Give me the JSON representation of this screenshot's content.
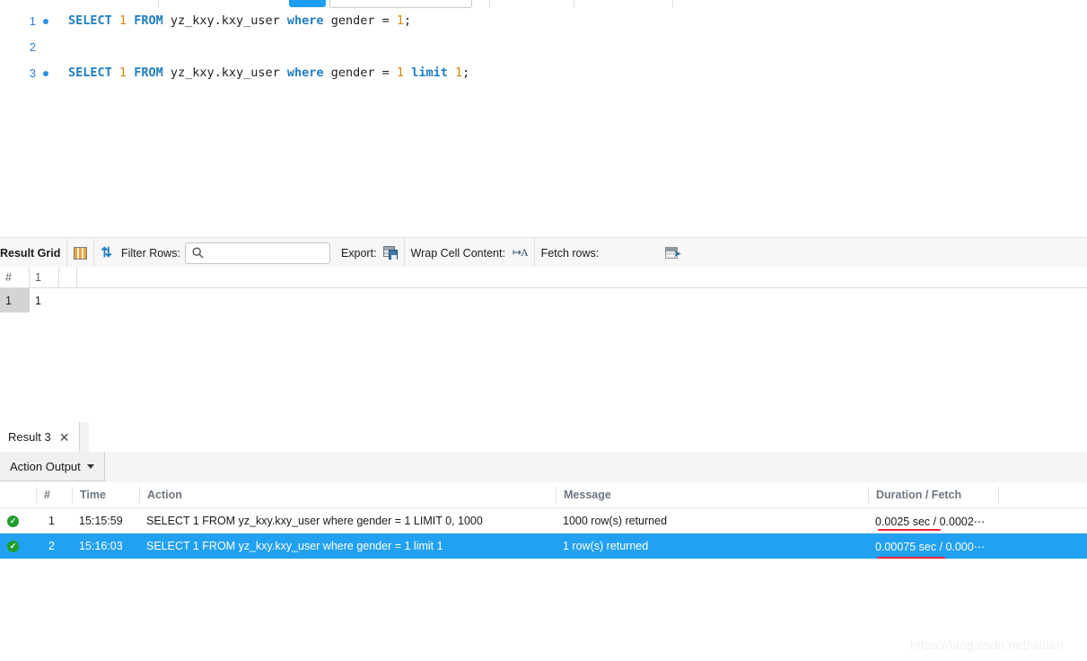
{
  "editor": {
    "lines": [
      {
        "number": "1",
        "has_marker": true,
        "tokens": [
          {
            "t": "SELECT",
            "c": "kw"
          },
          {
            "t": " ",
            "c": "punc"
          },
          {
            "t": "1",
            "c": "num"
          },
          {
            "t": " ",
            "c": "punc"
          },
          {
            "t": "FROM",
            "c": "kw"
          },
          {
            "t": " ",
            "c": "punc"
          },
          {
            "t": "yz_kxy.kxy_user",
            "c": "ident"
          },
          {
            "t": " ",
            "c": "punc"
          },
          {
            "t": "where",
            "c": "kw"
          },
          {
            "t": " ",
            "c": "punc"
          },
          {
            "t": "gender",
            "c": "ident"
          },
          {
            "t": " = ",
            "c": "punc"
          },
          {
            "t": "1",
            "c": "num"
          },
          {
            "t": ";",
            "c": "punc"
          }
        ],
        "plain": "SELECT 1 FROM yz_kxy.kxy_user where gender = 1;"
      },
      {
        "number": "2",
        "has_marker": false,
        "tokens": [],
        "plain": ""
      },
      {
        "number": "3",
        "has_marker": true,
        "tokens": [
          {
            "t": "SELECT",
            "c": "kw"
          },
          {
            "t": " ",
            "c": "punc"
          },
          {
            "t": "1",
            "c": "num"
          },
          {
            "t": " ",
            "c": "punc"
          },
          {
            "t": "FROM",
            "c": "kw"
          },
          {
            "t": " ",
            "c": "punc"
          },
          {
            "t": "yz_kxy.kxy_user",
            "c": "ident"
          },
          {
            "t": " ",
            "c": "punc"
          },
          {
            "t": "where",
            "c": "kw"
          },
          {
            "t": " ",
            "c": "punc"
          },
          {
            "t": "gender",
            "c": "ident"
          },
          {
            "t": " = ",
            "c": "punc"
          },
          {
            "t": "1",
            "c": "num"
          },
          {
            "t": " ",
            "c": "punc"
          },
          {
            "t": "limit",
            "c": "kw"
          },
          {
            "t": " ",
            "c": "punc"
          },
          {
            "t": "1",
            "c": "num"
          },
          {
            "t": ";",
            "c": "punc"
          }
        ],
        "plain": "SELECT 1 FROM yz_kxy.kxy_user where gender = 1 limit 1;"
      }
    ]
  },
  "grid_toolbar": {
    "title": "Result Grid",
    "grid_icon": "grid-icon",
    "refresh_icon": "refresh-icon",
    "filter_label": "Filter Rows:",
    "filter_value": "",
    "filter_placeholder": "",
    "search_icon": "search-icon",
    "export_label": "Export:",
    "export_icon": "export-icon",
    "wrap_label": "Wrap Cell Content:",
    "wrap_icon": "wrap-cell-icon",
    "fetch_label": "Fetch rows:",
    "fetch_icon": "fetch-rows-icon"
  },
  "result_grid": {
    "columns": [
      "#",
      "1"
    ],
    "rows": [
      {
        "row_header": "1",
        "values": [
          "1"
        ],
        "selected": true
      }
    ]
  },
  "result_tabs": {
    "tabs": [
      {
        "label": "Result 3",
        "close_icon": "close-icon",
        "active": true
      }
    ]
  },
  "action_output": {
    "dropdown_label": "Action Output",
    "caret_icon": "chevron-down-icon",
    "columns": [
      "#",
      "Time",
      "Action",
      "Message",
      "Duration / Fetch"
    ],
    "rows": [
      {
        "status": "success",
        "status_icon": "check-circle-icon",
        "num": "1",
        "time": "15:15:59",
        "action": "SELECT 1 FROM yz_kxy.kxy_user where gender = 1 LIMIT 0, 1000",
        "message": "1000 row(s) returned",
        "duration": "0.0025 sec / 0.0002⋯",
        "selected": false
      },
      {
        "status": "success",
        "status_icon": "check-circle-icon",
        "num": "2",
        "time": "15:16:03",
        "action": "SELECT 1 FROM yz_kxy.kxy_user where gender = 1 limit 1",
        "message": "1 row(s) returned",
        "duration": "0.00075 sec / 0.000⋯",
        "selected": true
      }
    ]
  },
  "annotations": {
    "underline_color": "#f5223c",
    "underline_count": 2
  },
  "watermark": {
    "text": "https://blog.csdn.net/wltian"
  }
}
